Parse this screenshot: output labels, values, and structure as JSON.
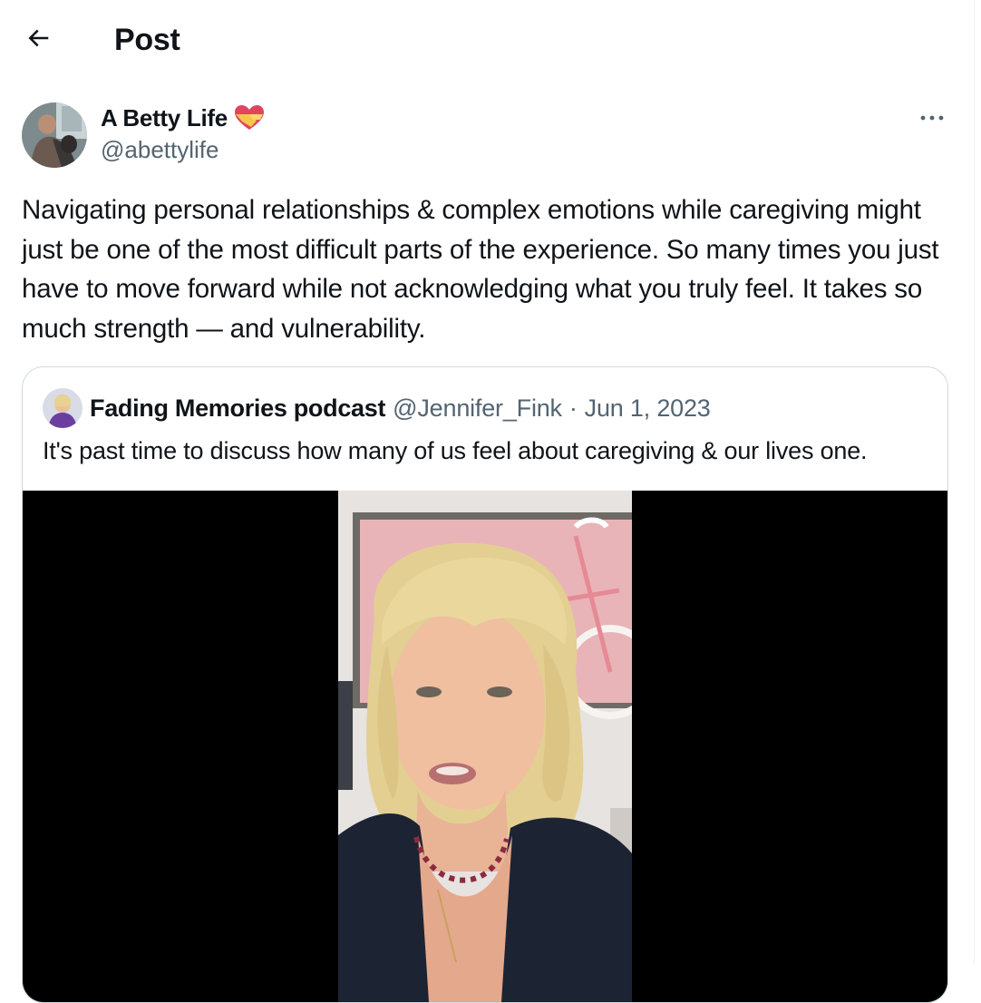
{
  "header": {
    "title": "Post",
    "back_icon": "arrow-left-icon"
  },
  "post": {
    "author": {
      "display_name": "A Betty Life",
      "handle": "@abettylife",
      "badge_icon": "heart-emoji-icon"
    },
    "more_icon": "more-horizontal-icon",
    "text": "Navigating personal relationships & complex emotions while caregiving might just be one of the most difficult parts of the experience. So many times you just have to move forward while not acknowledging what you truly feel. It takes so much strength — and vulnerability."
  },
  "quote": {
    "author_name": "Fading Memories podcast",
    "handle": "@Jennifer_Fink",
    "separator": "·",
    "date": "Jun 1, 2023",
    "text": "It's past time to discuss how many of us feel about caregiving & our lives one.",
    "media": {
      "type": "video"
    }
  },
  "colors": {
    "text_primary": "#0f1419",
    "text_secondary": "#536471",
    "border": "#cfd9de",
    "media_background": "#000000"
  }
}
